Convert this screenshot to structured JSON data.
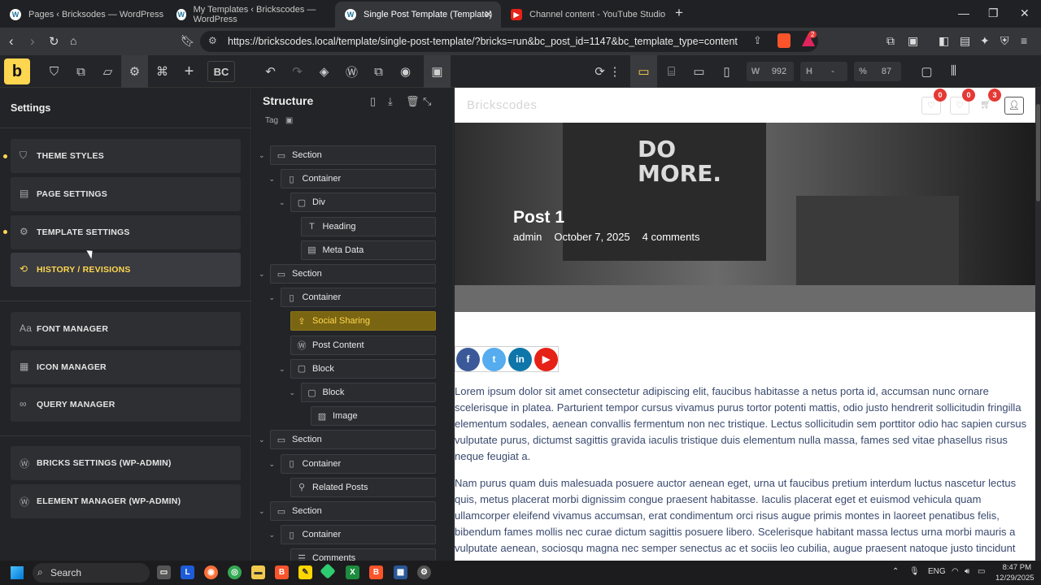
{
  "browser": {
    "tabs": [
      {
        "title": "Pages ‹ Bricksodes — WordPress",
        "icon": "wordpress-icon"
      },
      {
        "title": "My Templates ‹ Brickscodes — WordPress",
        "icon": "wordpress-icon"
      },
      {
        "title": "Single Post Template (Template)",
        "icon": "wordpress-icon",
        "active": true
      },
      {
        "title": "Channel content - YouTube Studio",
        "icon": "youtube-icon"
      }
    ],
    "url": "https://brickscodes.local/template/single-post-template/?bricks=run&bc_post_id=1147&bc_template_type=content",
    "shield_badge": "2"
  },
  "toolbar": {
    "logo": "b",
    "bc_label": "BC",
    "width_label": "W",
    "width_value": "992",
    "height_label": "H",
    "height_value": "-",
    "percent_label": "%",
    "percent_value": "87"
  },
  "settings": {
    "title": "Settings",
    "items": [
      {
        "label": "THEME STYLES",
        "icon": "theme-styles-icon",
        "dot": true
      },
      {
        "label": "PAGE SETTINGS",
        "icon": "page-settings-icon",
        "dot": false
      },
      {
        "label": "TEMPLATE SETTINGS",
        "icon": "gear-icon",
        "dot": true
      },
      {
        "label": "HISTORY / REVISIONS",
        "icon": "history-icon",
        "dot": false,
        "highlight": true
      },
      {
        "label": "FONT MANAGER",
        "icon": "font-icon"
      },
      {
        "label": "ICON MANAGER",
        "icon": "icon-manager-icon"
      },
      {
        "label": "QUERY MANAGER",
        "icon": "infinity-icon"
      },
      {
        "label": "BRICKS SETTINGS (WP-ADMIN)",
        "icon": "wordpress-icon"
      },
      {
        "label": "ELEMENT MANAGER (WP-ADMIN)",
        "icon": "wordpress-icon"
      }
    ]
  },
  "structure": {
    "title": "Structure",
    "tag_label": "Tag",
    "nodes": [
      {
        "label": "Section",
        "icon": "section-icon",
        "depth": 0
      },
      {
        "label": "Container",
        "icon": "container-icon",
        "depth": 1
      },
      {
        "label": "Div",
        "icon": "div-icon",
        "depth": 2
      },
      {
        "label": "Heading",
        "icon": "heading-icon",
        "depth": 3
      },
      {
        "label": "Meta Data",
        "icon": "meta-data-icon",
        "depth": 3
      },
      {
        "label": "Section",
        "icon": "section-icon",
        "depth": 0
      },
      {
        "label": "Container",
        "icon": "container-icon",
        "depth": 1
      },
      {
        "label": "Social Sharing",
        "icon": "share-icon",
        "depth": 2,
        "selected": true
      },
      {
        "label": "Post Content",
        "icon": "wordpress-icon",
        "depth": 2
      },
      {
        "label": "Block",
        "icon": "block-icon",
        "depth": 2
      },
      {
        "label": "Block",
        "icon": "block-icon",
        "depth": 3
      },
      {
        "label": "Image",
        "icon": "image-icon",
        "depth": 4
      },
      {
        "label": "Section",
        "icon": "section-icon",
        "depth": 0
      },
      {
        "label": "Container",
        "icon": "container-icon",
        "depth": 1
      },
      {
        "label": "Related Posts",
        "icon": "pin-icon",
        "depth": 2
      },
      {
        "label": "Section",
        "icon": "section-icon",
        "depth": 0
      },
      {
        "label": "Container",
        "icon": "container-icon",
        "depth": 1
      },
      {
        "label": "Comments",
        "icon": "comments-icon",
        "depth": 2
      }
    ]
  },
  "canvas": {
    "site_logo": "Brickscodes",
    "wishlist_count": "0",
    "compare_count": "0",
    "cart_count": "3",
    "hero_poster": "DO MORE.",
    "post_title": "Post 1",
    "author": "admin",
    "date": "October 7, 2025",
    "comments": "4 comments",
    "social": [
      "f",
      "t",
      "in",
      "▶"
    ],
    "paragraph1": "Lorem ipsum dolor sit amet consectetur adipiscing elit, faucibus habitasse a netus porta id, accumsan nunc ornare scelerisque in platea. Parturient tempor cursus vivamus purus tortor potenti mattis, odio justo hendrerit sollicitudin fringilla elementum sodales, aenean convallis fermentum non nec tristique. Lectus sollicitudin sem porttitor odio hac sapien cursus vulputate purus, dictumst sagittis gravida iaculis tristique duis elementum nulla massa, fames sed vitae phasellus risus neque feugiat a.",
    "paragraph2": "Nam purus quam duis malesuada posuere auctor aenean eget, urna ut faucibus pretium interdum luctus nascetur lectus quis, metus placerat morbi dignissim congue praesent habitasse. Iaculis placerat eget et euismod vehicula quam ullamcorper eleifend vivamus accumsan, erat condimentum orci risus augue primis montes in laoreet penatibus felis, bibendum fames mollis nec curae dictum sagittis posuere libero. Scelerisque habitant massa lectus urna morbi mauris a vulputate aenean, sociosqu magna nec semper senectus ac et sociis leo cubilia, augue praesent natoque justo tincidunt"
  },
  "taskbar": {
    "search_label": "Search",
    "lang": "ENG",
    "time": "8:47 PM",
    "date": "12/29/2025"
  },
  "colors": {
    "accent": "#ffd64f",
    "facebook": "#3b5998",
    "twitter": "#55acee",
    "linkedin": "#0e76a8",
    "youtube": "#e62117"
  }
}
